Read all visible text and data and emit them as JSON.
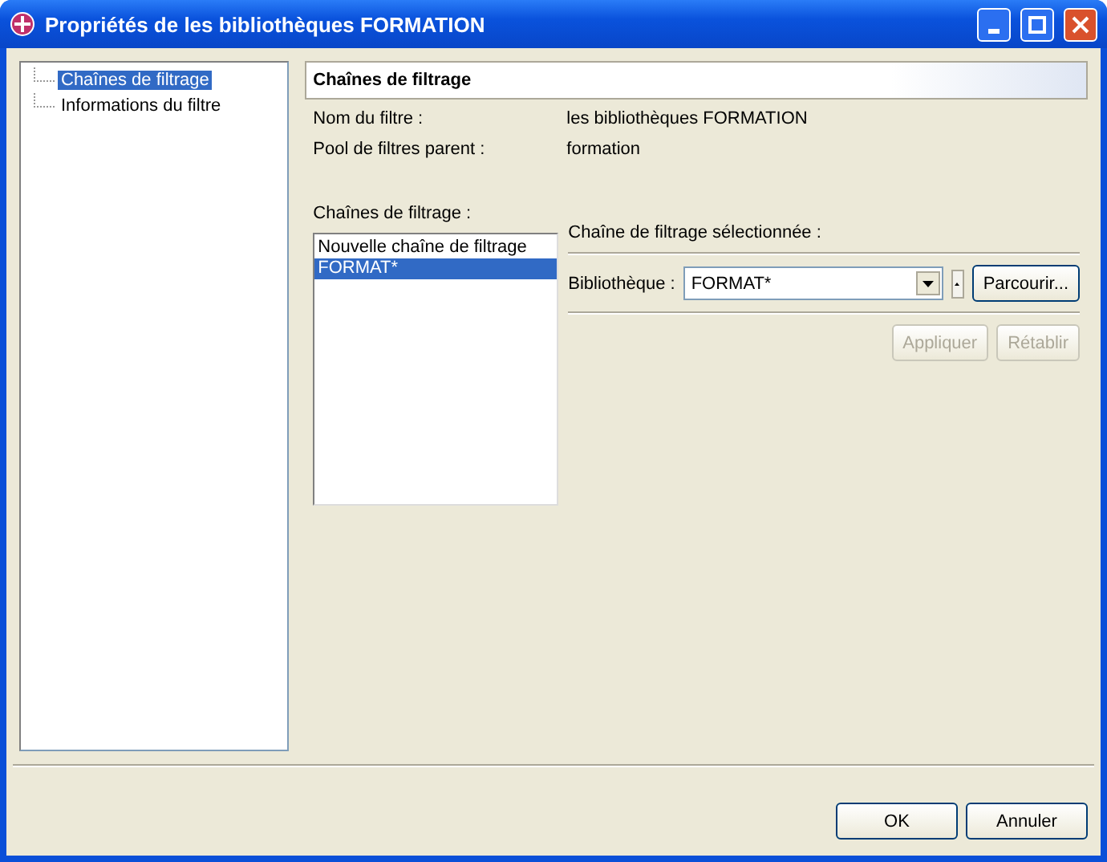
{
  "window": {
    "title": "Propriétés de les bibliothèques FORMATION"
  },
  "tree": {
    "items": [
      {
        "label": "Chaînes de filtrage",
        "selected": true
      },
      {
        "label": "Informations du filtre",
        "selected": false
      }
    ]
  },
  "page": {
    "title": "Chaînes de filtrage",
    "fields": [
      {
        "label": "Nom du filtre :",
        "value": "les bibliothèques FORMATION"
      },
      {
        "label": "Pool de filtres parent :",
        "value": "formation"
      }
    ],
    "list_label": "Chaînes de filtrage :",
    "list": [
      {
        "label": "Nouvelle chaîne de filtrage",
        "selected": false
      },
      {
        "label": "FORMAT*",
        "selected": true
      }
    ],
    "detail": {
      "title": "Chaîne de filtrage sélectionnée :",
      "field_label": "Bibliothèque :",
      "field_value": "FORMAT*",
      "browse": "Parcourir...",
      "buttons": [
        {
          "label": "Appliquer",
          "disabled": true
        },
        {
          "label": "Rétablir",
          "disabled": true
        }
      ]
    }
  },
  "buttons": [
    {
      "label": "OK",
      "disabled": false
    },
    {
      "label": "Annuler",
      "disabled": false
    }
  ]
}
